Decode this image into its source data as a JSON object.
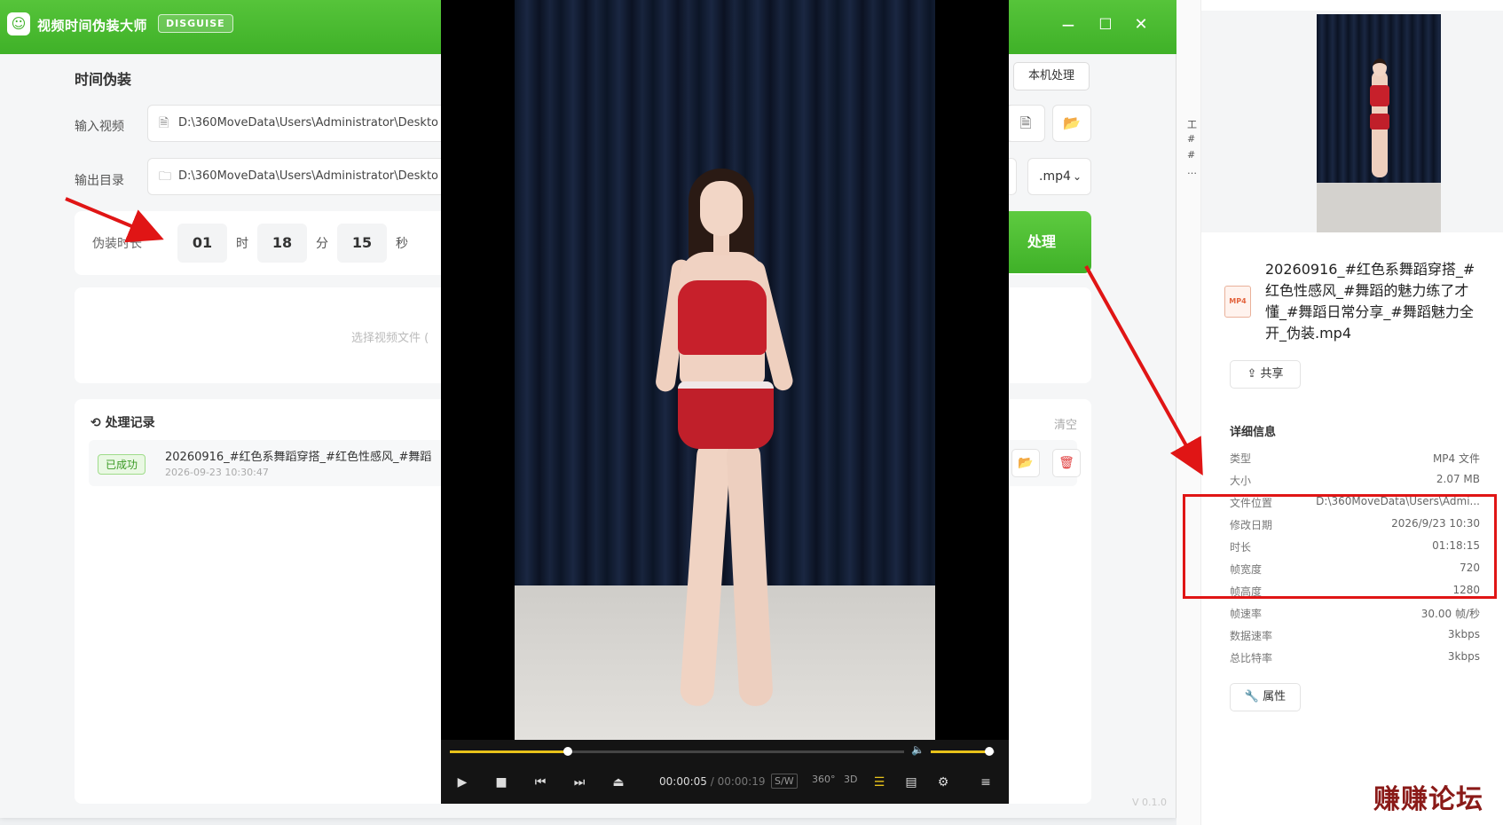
{
  "app": {
    "title": "视频时间伪装大师",
    "badge": "DISGUISE",
    "logo_glyph": "☺",
    "window_controls": {
      "min": "−",
      "max": "☐",
      "close": "✕"
    },
    "accent": "#3fb128"
  },
  "main": {
    "section_title": "时间伪装",
    "local_btn": "本机处理",
    "input_label": "输入视频",
    "input_value": "D:\\360MoveData\\Users\\Administrator\\Deskto",
    "output_label": "输出目录",
    "output_value": "D:\\360MoveData\\Users\\Administrator\\Deskto",
    "format": ".mp4",
    "duration": {
      "label": "伪装时长",
      "hours": "01",
      "hours_unit": "时",
      "minutes": "18",
      "minutes_unit": "分",
      "seconds": "15",
      "seconds_unit": "秒"
    },
    "process_btn": "处理",
    "drop_hint": "选择视频文件 (",
    "history": {
      "title": "处理记录",
      "clear": "清空",
      "items": [
        {
          "status": "已成功",
          "name": "20260916_#红色系舞蹈穿搭_#红色性感风_#舞蹈",
          "time": "2026-09-23 10:30:47"
        }
      ]
    },
    "version": "V 0.1.0"
  },
  "player": {
    "current_time": "00:00:05",
    "duration": "/ 00:00:19",
    "progress": 0.26,
    "volume": 0.92,
    "tags": {
      "sw": "S/W",
      "r360": "360°",
      "threed": "3D"
    }
  },
  "detail": {
    "edge_chars": [
      "工",
      "#",
      "#",
      "…"
    ],
    "file_badge": "MP4",
    "file_name": "20260916_#红色系舞蹈穿搭_#红色性感风_#舞蹈的魅力练了才懂_#舞蹈日常分享_#舞蹈魅力全开_伪装.mp4",
    "share": "共享",
    "info_title": "详细信息",
    "rows": [
      {
        "k": "类型",
        "v": "MP4 文件"
      },
      {
        "k": "大小",
        "v": "2.07 MB"
      },
      {
        "k": "文件位置",
        "v": "D:\\360MoveData\\Users\\Admi..."
      },
      {
        "k": "修改日期",
        "v": "2026/9/23 10:30"
      },
      {
        "k": "时长",
        "v": "01:18:15"
      },
      {
        "k": "帧宽度",
        "v": "720"
      },
      {
        "k": "帧高度",
        "v": "1280"
      },
      {
        "k": "帧速率",
        "v": "30.00 帧/秒"
      },
      {
        "k": "数据速率",
        "v": "3kbps"
      },
      {
        "k": "总比特率",
        "v": "3kbps"
      }
    ],
    "properties": "属性"
  },
  "watermark": "赚赚论坛",
  "colors": {
    "annotation": "#e01515"
  }
}
